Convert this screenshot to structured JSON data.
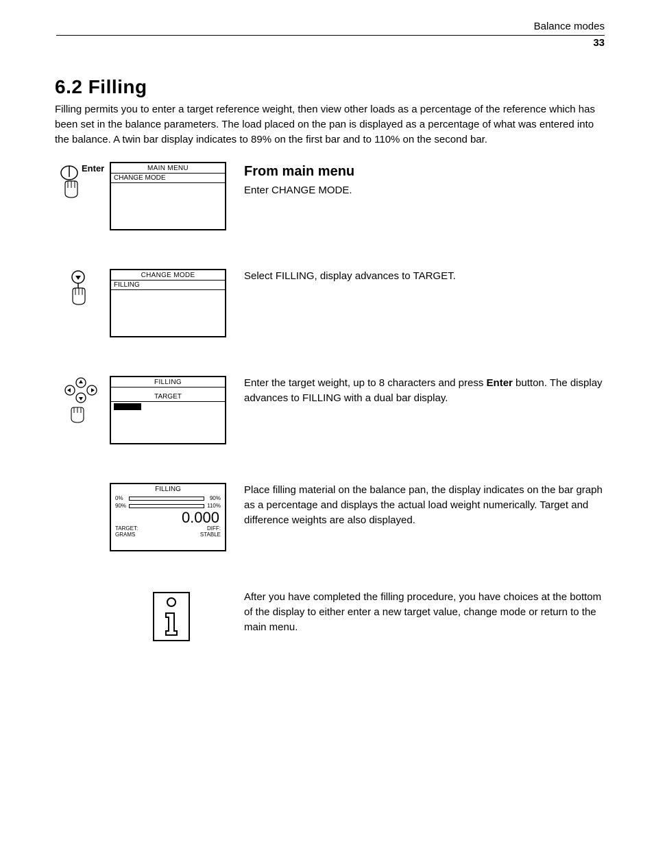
{
  "header": {
    "section": "Balance modes",
    "page": "33"
  },
  "title": "6.2  Filling",
  "intro": "Filling permits you to enter a target reference weight, then view other loads as a percentage of the reference which has been set in the balance parameters. The load placed on the pan is displayed as a percentage of what was entered into the balance. A twin bar display indicates to 89% on the first bar and to 110% on the second bar.",
  "steps": [
    {
      "icon_label": "Enter",
      "screen": {
        "title": "MAIN MENU",
        "row": "CHANGE MODE"
      },
      "heading": "From main menu",
      "text": "Enter CHANGE MODE."
    },
    {
      "screen": {
        "title": "CHANGE MODE",
        "row": "FILLING"
      },
      "text": "Select FILLING, display advances to TARGET."
    },
    {
      "screen": {
        "title": "FILLING",
        "sub": "TARGET"
      },
      "text_pre": "Enter the target weight, up to 8 characters and press ",
      "text_bold": "Enter",
      "text_post": " button. The display advances to FILLING with a dual bar display."
    },
    {
      "fill_screen": {
        "title": "FILLING",
        "bar1_l": "0%",
        "bar1_r": "90%",
        "bar2_l": "90%",
        "bar2_r": "110%",
        "reading": "0.000",
        "target_lbl": "TARGET:",
        "diff_lbl": "DIFF:",
        "unit": "GRAMS",
        "status": "STABLE"
      },
      "text": "Place filling material on the balance pan, the display indicates on the bar graph as a percentage and displays the actual load weight numerically. Target and difference weights are also displayed."
    },
    {
      "info_icon": true,
      "text": "After you have completed the filling procedure, you have choices at the bottom of the display to either enter a new target value, change mode or return to the main menu."
    }
  ]
}
